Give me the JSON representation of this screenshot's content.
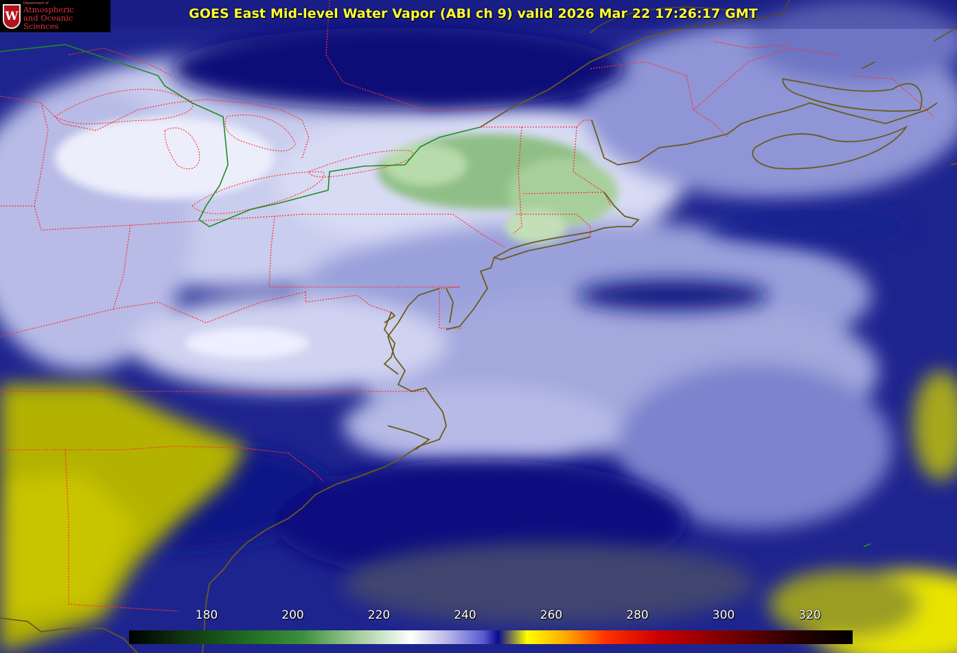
{
  "title": "GOES East Mid-level Water Vapor (ABI ch 9)  valid 2026 Mar 22 17:26:17 GMT",
  "logo": {
    "mark": "W",
    "department": "Department of",
    "line1": "Atmospheric",
    "line2": "and Oceanic Sciences"
  },
  "colorbar": {
    "ticks": [
      "180",
      "200",
      "220",
      "240",
      "260",
      "280",
      "300",
      "320"
    ]
  },
  "colors": {
    "dry_background": "#1a1f8a",
    "very_dry": "#b8b800",
    "moist": "#dde0f5",
    "cold_cloud": "#8fbf86",
    "state_borders": "#ff3030",
    "coastlines": "#6b5a1a",
    "canada_us_border": "#1f8a1f",
    "title_text": "#ffff33"
  }
}
